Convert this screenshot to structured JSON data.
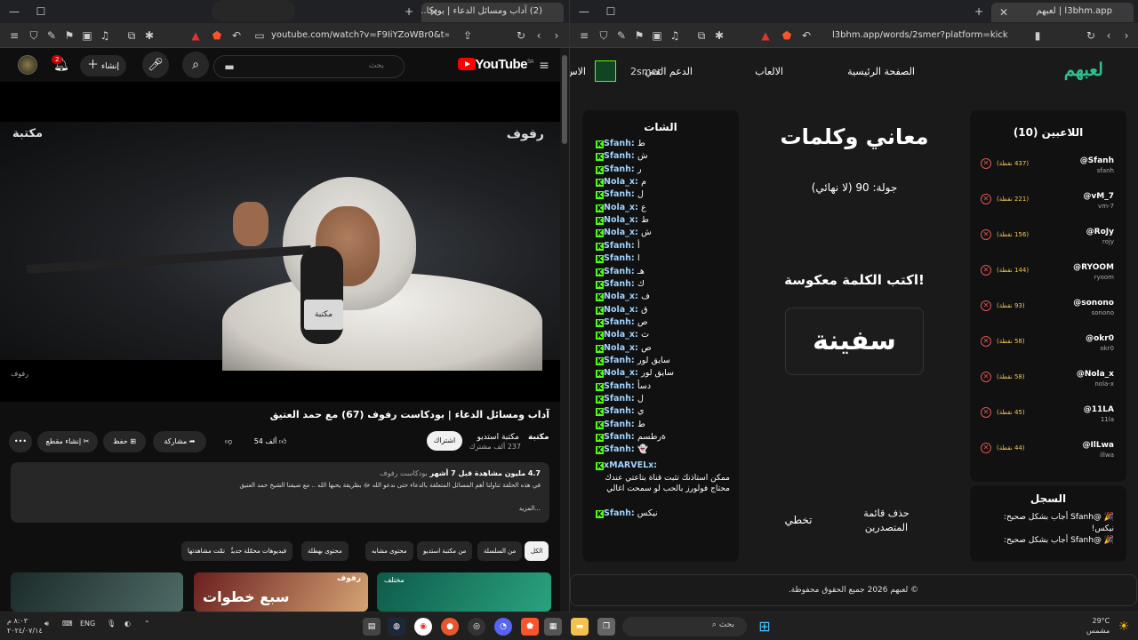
{
  "left_browser": {
    "tab_title": "(2) آداب ومسائل الدعاء | بودكا...",
    "url": "youtube.com/watch?v=F9IiYZoWBr0&t=3...",
    "badge": "2"
  },
  "youtube": {
    "logo": "YouTube",
    "logo_region": "SA",
    "search_placeholder": "بحث",
    "create_label": "إنشاء",
    "notif_count": "2",
    "video": {
      "watermark_right": "رفوف",
      "watermark_left": "مكتبة",
      "watermark_bottom": "رفوف",
      "mic_flag": "مكتبة",
      "title": "آداب ومسائل الدعاء | بودكاست رفوف (67) مع حمد العتيق",
      "channel_name": "مكتبة استديو",
      "channel_logo": "مكتبة",
      "subscribers": "237 ألف مشترك",
      "subscribe_label": "اشتراك",
      "likes": "54 ألف",
      "share_label": "مشاركة",
      "save_label": "حفظ",
      "clip_label": "إنشاء مقطع",
      "more_label": "•••"
    },
    "description": {
      "views": "4.7 مليون مشاهدة قبل 7 أشهر",
      "tag": "بودكاست رفوف",
      "text": "في هذه الحلقة تناولنا أهم المسائل المتعلقة بالدعاء حتى ندعو الله ﷻ بطريقة يحبها الله .. مع ضيفنا الشيخ حمد العتيق",
      "more": "...المزيد"
    },
    "chips": [
      "الكل",
      "من السلسلة",
      "من مكتبة استديو",
      "محتوى مشابه",
      "محتوى بهطلة",
      "فيديوهات محمّلة حديثًا",
      "تمّت مشاهدتها"
    ],
    "thumbs": [
      "سبع خطوات",
      "مختلف",
      "رفوف"
    ]
  },
  "right_browser": {
    "tab_title": "l3bhm.app | لعبهم",
    "url": "l3bhm.app/words/2smer?platform=kick"
  },
  "site": {
    "brand": "لعبهم",
    "nav": {
      "home": "الصفحة الرئيسية",
      "games": "الالعاب",
      "support": "الدعم الفني",
      "user": "2smer",
      "more": "الاس"
    },
    "players_title": "اللاعبين (10)",
    "players": [
      {
        "name": "@Sfanh",
        "sub": "sfanh",
        "points": "(437 نقطة)"
      },
      {
        "name": "@vM_7",
        "sub": "vm-7",
        "points": "(221 نقطة)"
      },
      {
        "name": "@RoJy",
        "sub": "rojy",
        "points": "(156 نقطة)"
      },
      {
        "name": "@RYOOM",
        "sub": "ryoom",
        "points": "(144 نقطة)"
      },
      {
        "name": "@sonono",
        "sub": "sonono",
        "points": "(93 نقطة)"
      },
      {
        "name": "@okr0",
        "sub": "okr0",
        "points": "(58 نقطة)"
      },
      {
        "name": "@Nola_x",
        "sub": "nola-x",
        "points": "(58 نقطة)"
      },
      {
        "name": "@11LA",
        "sub": "11la",
        "points": "(45 نقطة)"
      },
      {
        "name": "@IlLwa",
        "sub": "illwa",
        "points": "(44 نقطة)"
      }
    ],
    "game": {
      "title": "معاني وكلمات",
      "round": "جولة: 90 (لا نهائي)",
      "prompt": "اكتب الكلمة معكوسة!",
      "word": "سفينة",
      "clear_label": "حذف قائمة المتصدرين",
      "skip_label": "تخطي"
    },
    "log_title": "السجل",
    "log": [
      "🎉 @Sfanh أجاب بشكل صحيح: نيكس!",
      "🎉 @Sfanh أجاب بشكل صحيح:"
    ],
    "chat_title": "الشات",
    "chat": [
      {
        "u": "Sfanh",
        "m": "ط"
      },
      {
        "u": "Sfanh",
        "m": "ش"
      },
      {
        "u": "Sfanh",
        "m": "ر"
      },
      {
        "u": "Nola_x",
        "m": "م"
      },
      {
        "u": "Sfanh",
        "m": "ل"
      },
      {
        "u": "Nola_x",
        "m": "ع"
      },
      {
        "u": "Nola_x",
        "m": "ط"
      },
      {
        "u": "Nola_x",
        "m": "ش"
      },
      {
        "u": "Sfanh",
        "m": "أ"
      },
      {
        "u": "Sfanh",
        "m": "ا"
      },
      {
        "u": "Sfanh",
        "m": "هـ"
      },
      {
        "u": "Sfanh",
        "m": "ك"
      },
      {
        "u": "Nola_x",
        "m": "ف"
      },
      {
        "u": "Nola_x",
        "m": "ق"
      },
      {
        "u": "Sfanh",
        "m": "ص"
      },
      {
        "u": "Nola_x",
        "m": "ث"
      },
      {
        "u": "Nola_x",
        "m": "ص"
      },
      {
        "u": "Sfanh",
        "m": "سايق لور"
      },
      {
        "u": "Nola_x",
        "m": "سايق لور"
      },
      {
        "u": "Sfanh",
        "m": "دسأ"
      },
      {
        "u": "Sfanh",
        "m": "ل"
      },
      {
        "u": "Sfanh",
        "m": "ي"
      },
      {
        "u": "Sfanh",
        "m": "ط"
      },
      {
        "u": "Sfanh",
        "m": "ةرطسم"
      },
      {
        "u": "Sfanh",
        "m": "👻"
      }
    ],
    "chat_marvel_user": "xMARVELx",
    "chat_marvel_msg": "ممكن استاذنك تثبت قناة بتاعتي عندك محتاج فولورز بالحب لو سمحت اغالي",
    "chat_last": {
      "u": "Sfanh",
      "m": "نيكس"
    },
    "footer": "© لعبهم 2026 جميع الحقوق محفوظة."
  },
  "taskbar": {
    "time": "٨:٠٣ م",
    "date": "٢٠٢٤/٠٧/١٤",
    "lang": "ENG",
    "search": "بحث",
    "weather_temp": "29°C",
    "weather_desc": "مشمس"
  }
}
